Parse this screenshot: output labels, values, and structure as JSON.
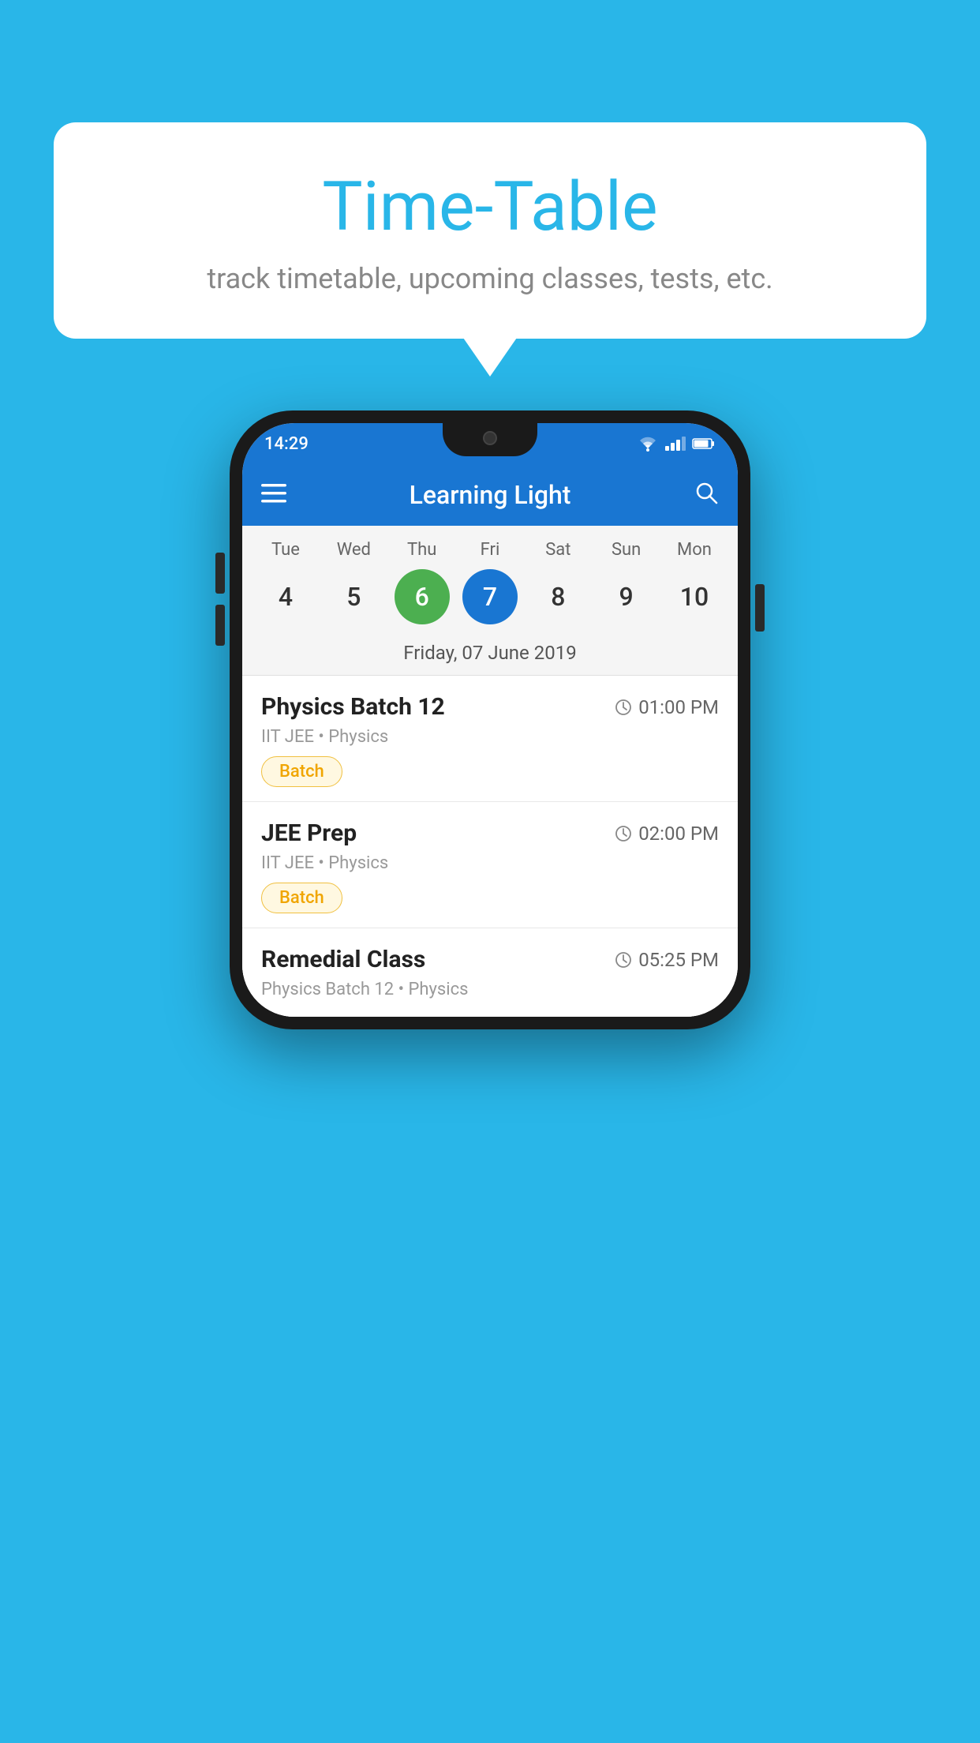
{
  "page": {
    "background_color": "#29b6e8"
  },
  "speech_bubble": {
    "title": "Time-Table",
    "subtitle": "track timetable, upcoming classes, tests, etc."
  },
  "phone": {
    "status_bar": {
      "time": "14:29"
    },
    "app_bar": {
      "title": "Learning Light"
    },
    "calendar": {
      "days": [
        "Tue",
        "Wed",
        "Thu",
        "Fri",
        "Sat",
        "Sun",
        "Mon"
      ],
      "dates": [
        "4",
        "5",
        "6",
        "7",
        "8",
        "9",
        "10"
      ],
      "today_index": 2,
      "selected_index": 3,
      "selected_label": "Friday, 07 June 2019"
    },
    "events": [
      {
        "title": "Physics Batch 12",
        "time": "01:00 PM",
        "meta": "IIT JEE • Physics",
        "badge": "Batch",
        "badge_type": "batch"
      },
      {
        "title": "JEE Prep",
        "time": "02:00 PM",
        "meta": "IIT JEE • Physics",
        "badge": "Batch",
        "badge_type": "batch"
      },
      {
        "title": "Remedial Class",
        "time": "05:25 PM",
        "meta": "Physics Batch 12 • Physics",
        "badge": "",
        "badge_type": ""
      }
    ]
  }
}
